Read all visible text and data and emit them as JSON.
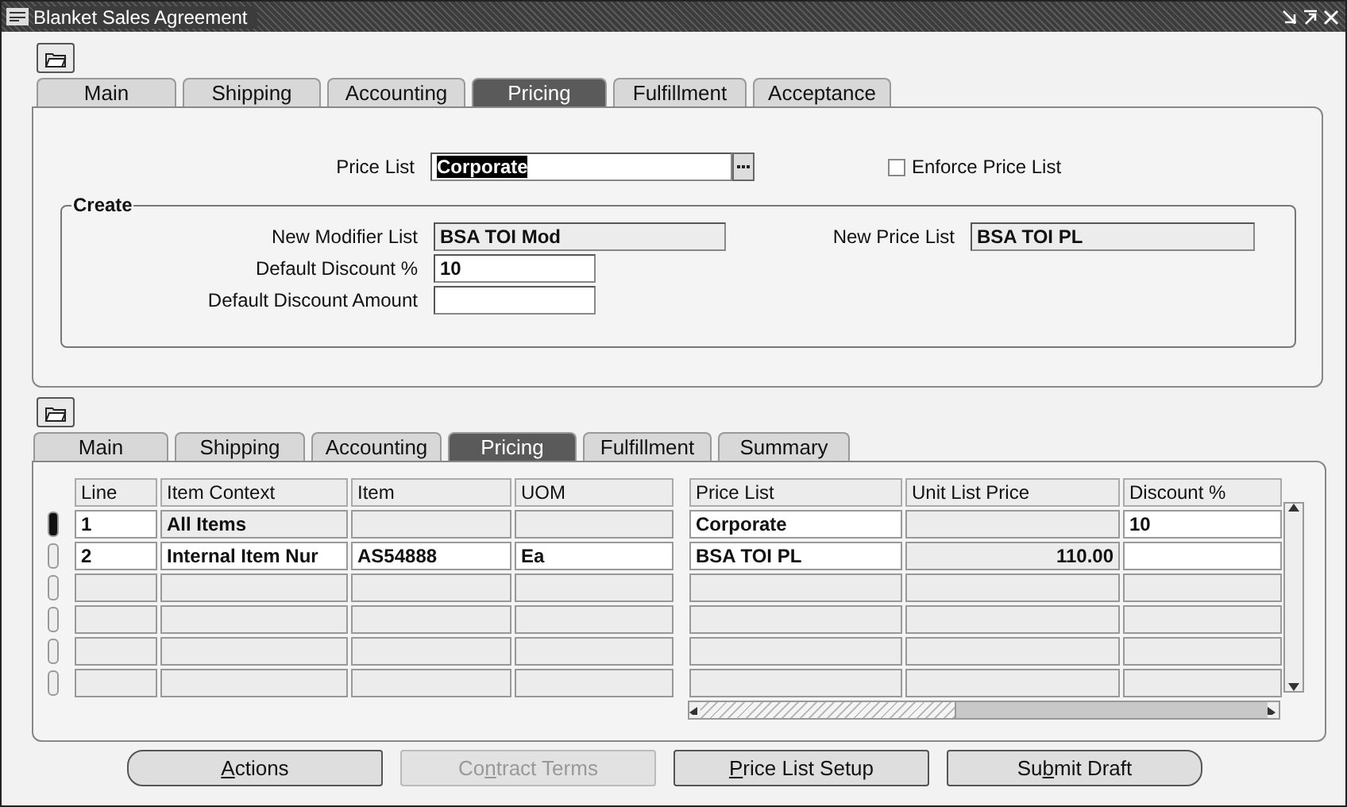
{
  "window": {
    "title": "Blanket Sales Agreement"
  },
  "header_tabs": [
    {
      "label": "Main",
      "selected": false
    },
    {
      "label": "Shipping",
      "selected": false
    },
    {
      "label": "Accounting",
      "selected": false
    },
    {
      "label": "Pricing",
      "selected": true
    },
    {
      "label": "Fulfillment",
      "selected": false
    },
    {
      "label": "Acceptance",
      "selected": false
    }
  ],
  "header": {
    "price_list": {
      "label": "Price List",
      "value": "Corporate",
      "highlighted": true
    },
    "enforce_price_list": {
      "label": "Enforce Price List",
      "checked": false
    },
    "create": {
      "title": "Create",
      "left_fields": [
        {
          "label": "New Modifier List",
          "value": "BSA TOI Mod",
          "editable": false
        },
        {
          "label": "Default Discount %",
          "value": "10",
          "editable": true
        },
        {
          "label": "Default Discount Amount",
          "editable": true
        }
      ],
      "right_fields": [
        {
          "label": "New Price List",
          "value": "BSA TOI PL",
          "editable": false
        }
      ]
    }
  },
  "line_tabs": [
    {
      "label": "Main",
      "selected": false
    },
    {
      "label": "Shipping",
      "selected": false
    },
    {
      "label": "Accounting",
      "selected": false
    },
    {
      "label": "Pricing",
      "selected": true
    },
    {
      "label": "Fulfillment",
      "selected": false
    },
    {
      "label": "Summary",
      "selected": false
    }
  ],
  "lines_table": {
    "columns": [
      "Line",
      "Item Context",
      "Item",
      "UOM",
      "Price List",
      "Unit List Price",
      "Discount %"
    ],
    "rows": [
      {
        "selected": true,
        "cells": [
          {
            "text": "1",
            "editable": true
          },
          {
            "text": "All Items",
            "editable": false
          },
          {
            "editable": false
          },
          {
            "editable": false
          },
          {
            "text": "Corporate",
            "editable": true
          },
          {
            "editable": false
          },
          {
            "text": "10",
            "editable": true
          }
        ]
      },
      {
        "selected": false,
        "cells": [
          {
            "text": "2",
            "editable": true
          },
          {
            "text": "Internal Item Nur",
            "editable": true
          },
          {
            "text": "AS54888",
            "editable": true
          },
          {
            "text": "Ea",
            "editable": true
          },
          {
            "text": "BSA TOI PL",
            "editable": true
          },
          {
            "text": "110.00",
            "editable": false
          },
          {
            "editable": true
          }
        ]
      },
      {
        "selected": false,
        "cells": [
          {
            "editable": false
          },
          {
            "editable": false
          },
          {
            "editable": false
          },
          {
            "editable": false
          },
          {
            "editable": false
          },
          {
            "editable": false
          },
          {
            "editable": false
          }
        ]
      },
      {
        "selected": false,
        "cells": [
          {
            "editable": false
          },
          {
            "editable": false
          },
          {
            "editable": false
          },
          {
            "editable": false
          },
          {
            "editable": false
          },
          {
            "editable": false
          },
          {
            "editable": false
          }
        ]
      },
      {
        "selected": false,
        "cells": [
          {
            "editable": false
          },
          {
            "editable": false
          },
          {
            "editable": false
          },
          {
            "editable": false
          },
          {
            "editable": false
          },
          {
            "editable": false
          },
          {
            "editable": false
          }
        ]
      },
      {
        "selected": false,
        "cells": [
          {
            "editable": false
          },
          {
            "editable": false
          },
          {
            "editable": false
          },
          {
            "editable": false
          },
          {
            "editable": false
          },
          {
            "editable": false
          },
          {
            "editable": false
          }
        ]
      }
    ]
  },
  "buttons": [
    {
      "key": "A",
      "after": "ctions",
      "disabled": false
    },
    {
      "before": "Co",
      "key": "n",
      "after": "tract Terms",
      "disabled": true
    },
    {
      "key": "P",
      "after": "rice List Setup",
      "disabled": false
    },
    {
      "before": "Su",
      "key": "b",
      "after": "mit Draft",
      "disabled": false
    }
  ]
}
